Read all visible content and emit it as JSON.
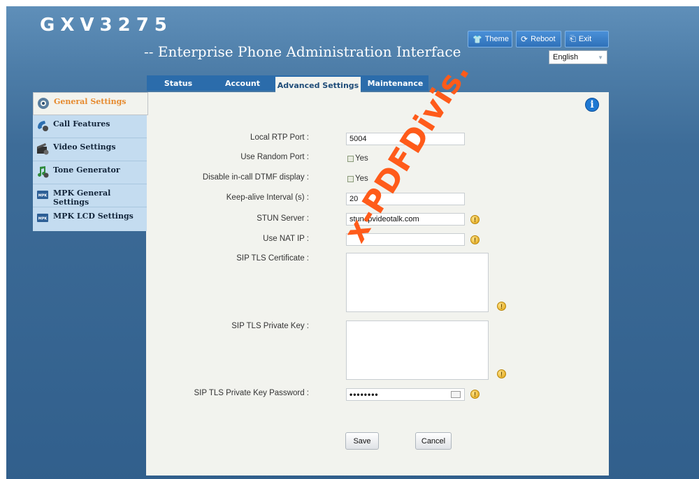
{
  "header": {
    "brand": "GXV3275",
    "subtitle": "-- Enterprise Phone Administration Interface",
    "buttons": {
      "theme": "Theme",
      "reboot": "Reboot",
      "exit": "Exit"
    },
    "language": "English"
  },
  "tabs": [
    {
      "label": "Status"
    },
    {
      "label": "Account"
    },
    {
      "label": "Advanced Settings"
    },
    {
      "label": "Maintenance"
    }
  ],
  "sidebar": {
    "items": [
      {
        "label": "General Settings",
        "icon": "gear-icon"
      },
      {
        "label": "Call Features",
        "icon": "phone-icon"
      },
      {
        "label": "Video Settings",
        "icon": "film-icon"
      },
      {
        "label": "Tone Generator",
        "icon": "music-note-icon"
      },
      {
        "label": "MPK General Settings",
        "icon": "mpk-icon"
      },
      {
        "label": "MPK LCD Settings",
        "icon": "mpk-icon"
      }
    ]
  },
  "form": {
    "local_rtp_port": {
      "label": "Local RTP Port :",
      "value": "5004"
    },
    "use_random_port": {
      "label": "Use Random Port :",
      "option": "Yes"
    },
    "disable_dtmf": {
      "label": "Disable in-call DTMF display :",
      "option": "Yes"
    },
    "keep_alive": {
      "label": "Keep-alive Interval (s) :",
      "value": "20"
    },
    "stun_server": {
      "label": "STUN Server :",
      "value": "stun.ipvideotalk.com"
    },
    "use_nat_ip": {
      "label": "Use NAT IP :",
      "value": ""
    },
    "sip_tls_cert": {
      "label": "SIP TLS Certificate  :"
    },
    "sip_tls_key": {
      "label": "SIP TLS Private Key  :"
    },
    "sip_tls_key_password": {
      "label": "SIP TLS Private Key Password :",
      "value": "••••••••"
    }
  },
  "actions": {
    "save": "Save",
    "cancel": "Cancel"
  },
  "watermark": "x-PDFDivis.",
  "colors": {
    "accent": "#2b6cab",
    "active_tab_text": "#1f4c78",
    "active_sidebar_text": "#e68a2e",
    "watermark": "#ff5b1a"
  }
}
